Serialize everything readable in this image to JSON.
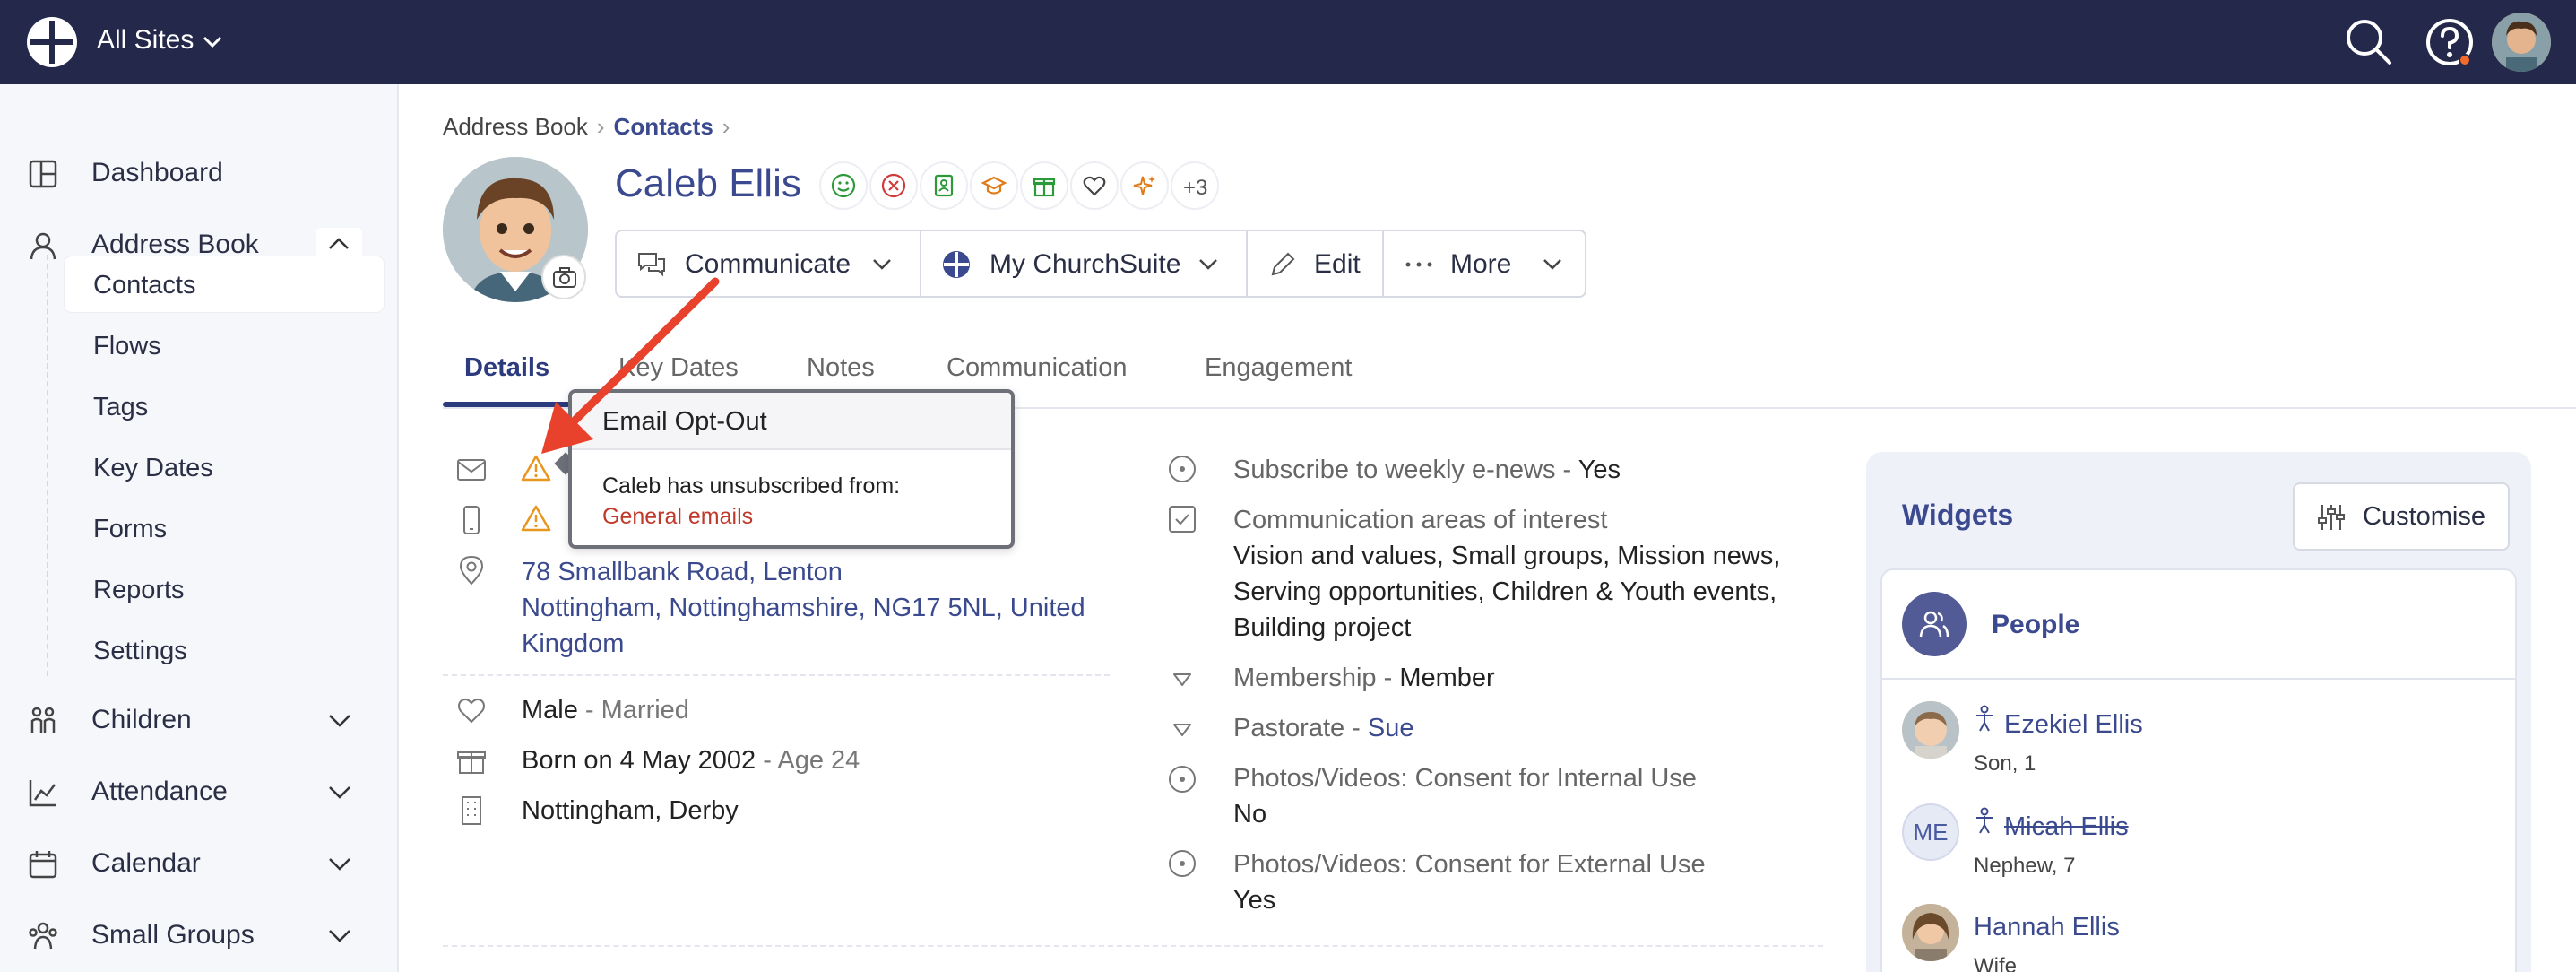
{
  "topbar": {
    "site_label": "All Sites",
    "icons": [
      "churchsuite-logo-icon",
      "search-icon",
      "help-icon",
      "avatar"
    ]
  },
  "sidebar": {
    "items": [
      {
        "label": "Dashboard",
        "icon": "dashboard-icon"
      },
      {
        "label": "Address Book",
        "icon": "person-icon",
        "expanded": true
      },
      {
        "label": "Children",
        "icon": "children-icon"
      },
      {
        "label": "Attendance",
        "icon": "chart-icon"
      },
      {
        "label": "Calendar",
        "icon": "calendar-icon"
      },
      {
        "label": "Small Groups",
        "icon": "groups-icon"
      }
    ],
    "subitems": [
      "Contacts",
      "Flows",
      "Tags",
      "Key Dates",
      "Forms",
      "Reports",
      "Settings"
    ],
    "active_subitem": "Contacts"
  },
  "breadcrumb": {
    "root": "Address Book",
    "current": "Contacts"
  },
  "contact": {
    "name": "Caleb Ellis",
    "tag_more": "+3"
  },
  "actions": {
    "communicate": "Communicate",
    "my_churchsuite": "My ChurchSuite",
    "edit": "Edit",
    "more": "More"
  },
  "tabs": [
    "Details",
    "Key Dates",
    "Notes",
    "Communication",
    "Engagement"
  ],
  "active_tab": "Details",
  "tooltip": {
    "title": "Email Opt-Out",
    "body": "Caleb has unsubscribed from:",
    "link": "General emails"
  },
  "details": {
    "address_line1": "78 Smallbank Road, Lenton",
    "address_line2": "Nottingham, Nottinghamshire, NG17 5NL, United",
    "address_line3": "Kingdom",
    "sex": "Male",
    "marital": "- Married",
    "born": "Born on 4 May 2002",
    "age": "- Age 24",
    "site": "Nottingham, Derby"
  },
  "fields": {
    "enews_label": "Subscribe to weekly e-news -",
    "enews_value": "Yes",
    "areas_label": "Communication areas of interest",
    "areas_line1": "Vision and values, Small groups, Mission news,",
    "areas_line2": "Serving opportunities, Children & Youth events,",
    "areas_line3": "Building project",
    "membership_label": "Membership -",
    "membership_value": "Member",
    "pastorate_label": "Pastorate -",
    "pastorate_value": "Sue",
    "internal_label": "Photos/Videos: Consent for Internal Use",
    "internal_value": "No",
    "external_label": "Photos/Videos: Consent for External Use",
    "external_value": "Yes"
  },
  "widgets": {
    "title": "Widgets",
    "customise": "Customise",
    "people_title": "People",
    "people": [
      {
        "name": "Ezekiel Ellis",
        "relation": "Son, 1",
        "child": true
      },
      {
        "name": "Micah Ellis",
        "relation": "Nephew, 7",
        "child": true,
        "initials": "ME",
        "archived": true
      },
      {
        "name": "Hannah Ellis",
        "relation": "Wife",
        "child": false
      }
    ]
  },
  "colors": {
    "topbar": "#24294b",
    "accent": "#3b4a8f",
    "warning": "#e8961e",
    "arrow": "#e8412c"
  }
}
